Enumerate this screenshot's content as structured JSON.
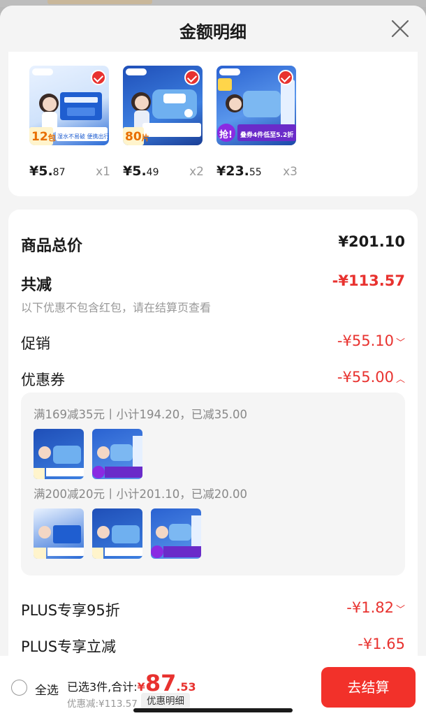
{
  "header": {
    "title": "金额明细"
  },
  "products": [
    {
      "price_main": "¥5.",
      "price_dec": "87",
      "qty": "x1",
      "badge": "12",
      "badge_unit": "包",
      "banner": "湿水不易破 便携出行"
    },
    {
      "price_main": "¥5.",
      "price_dec": "49",
      "qty": "x2",
      "badge": "80",
      "badge_unit": "片",
      "banner": ""
    },
    {
      "price_main": "¥23.",
      "price_dec": "55",
      "qty": "x3",
      "badge": "抢!",
      "badge_unit": "",
      "banner": "叠券4件低至5.2折"
    }
  ],
  "summary": {
    "total_label": "商品总价",
    "total_value": "¥201.10",
    "reduce_label": "共减",
    "reduce_value": "-¥113.57",
    "reduce_note": "以下优惠不包含红包，请在结算页查看",
    "promo_label": "促销",
    "promo_value": "-¥55.10",
    "coupon_label": "优惠券",
    "coupon_value": "-¥55.00",
    "plus1_label": "PLUS专享95折",
    "plus1_value": "-¥1.82",
    "plus2_label": "PLUS专享立减",
    "plus2_value": "-¥1.65"
  },
  "coupons": [
    {
      "desc": "满169减35元丨小计194.20，已减35.00"
    },
    {
      "desc": "满200减20元丨小计201.10，已减20.00"
    }
  ],
  "footer": {
    "select_all": "全选",
    "selected_text": "已选3件,合计:",
    "yen": "¥",
    "total_int": "87",
    "total_dec": ".53",
    "discount_text": "优惠减:¥113.57",
    "detail_btn": "优惠明细",
    "checkout_btn": "去结算"
  },
  "colors": {
    "accent_red": "#e8322f",
    "checkout_red": "#f2312a",
    "card_bg": "#ffffff",
    "page_bg": "#f4f4f4"
  }
}
